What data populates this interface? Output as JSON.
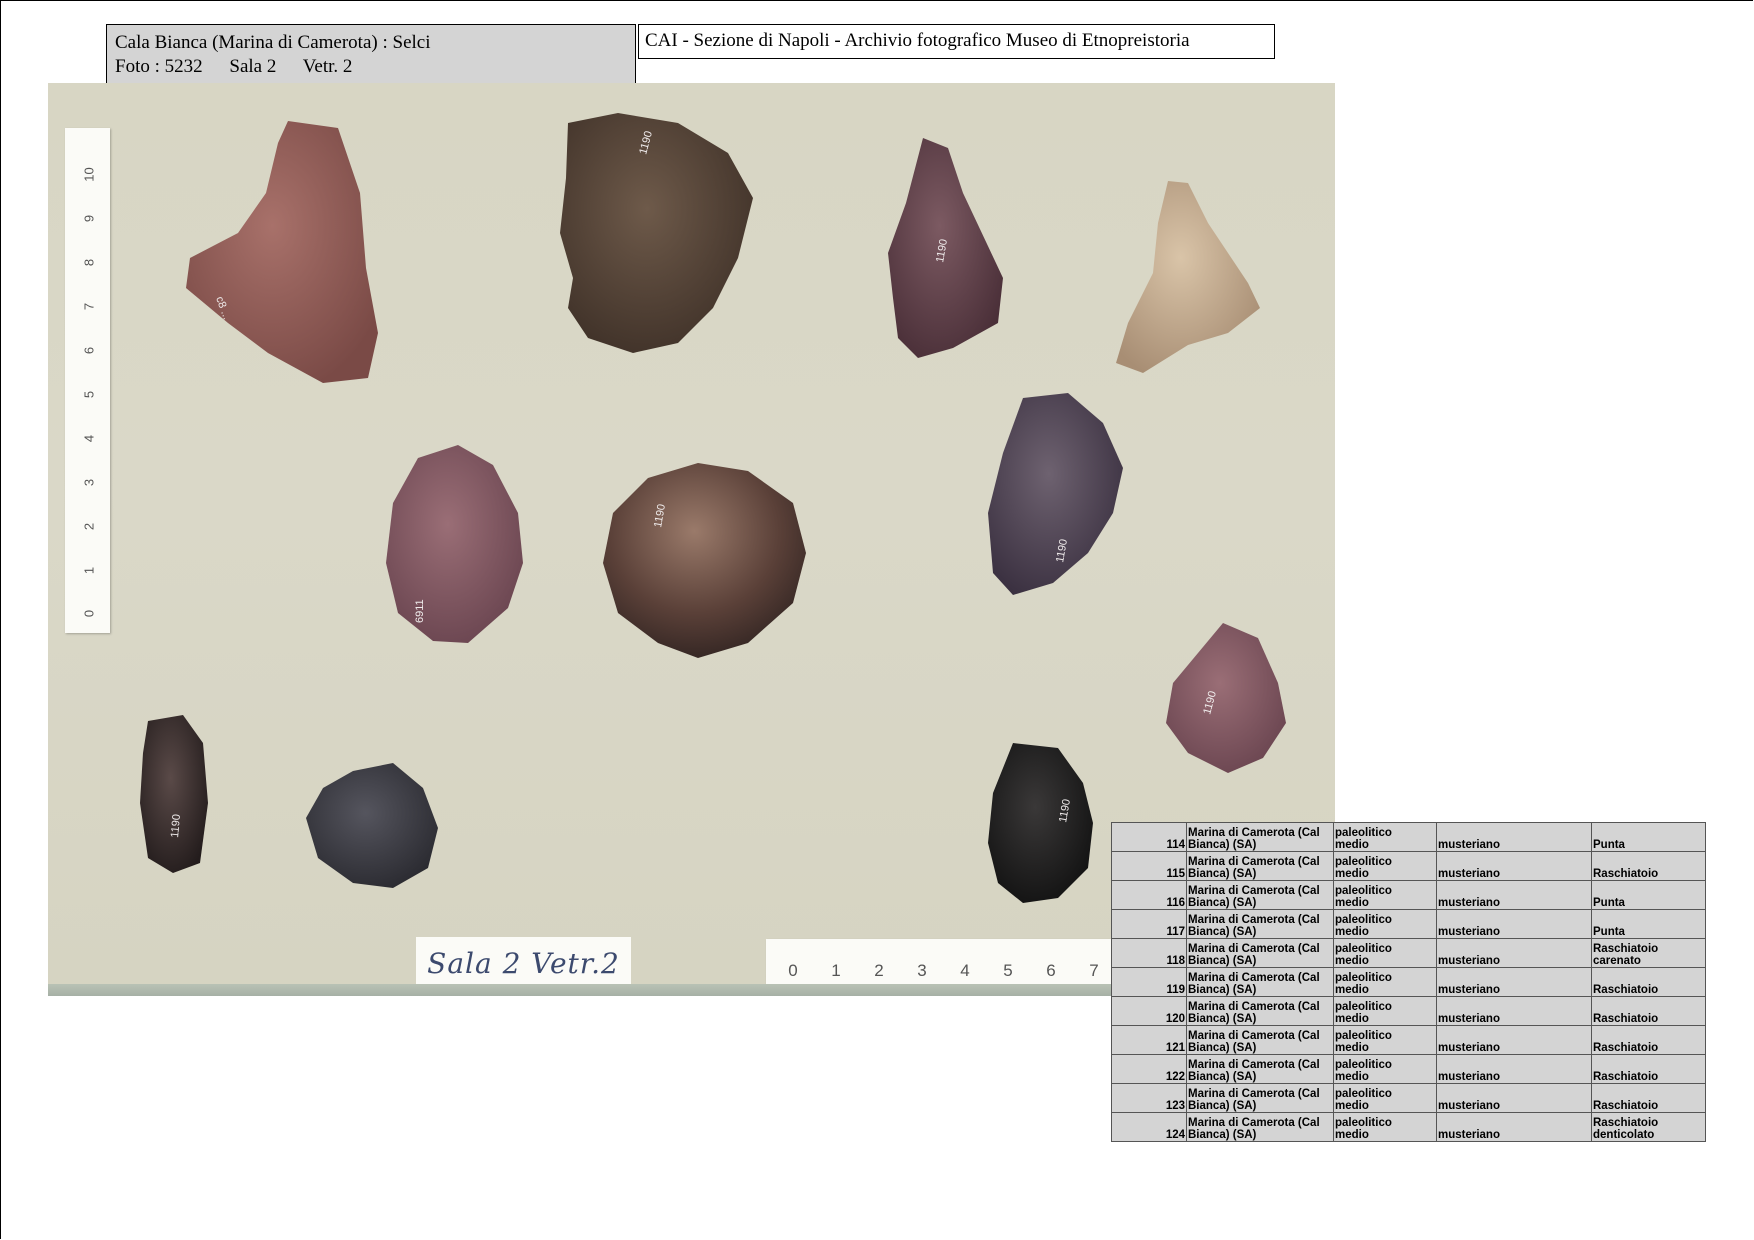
{
  "caption": {
    "title": "Cala Bianca  (Marina di Camerota)  : Selci",
    "photo": "Foto :  5232",
    "sala": "Sala  2",
    "vetr": "Vetr.  2"
  },
  "archive": "CAI - Sezione di Napoli  - Archivio fotografico Museo di Etnopreistoria",
  "photo": {
    "ruler_vertical_marks": [
      "0",
      "1",
      "2",
      "3",
      "4",
      "5",
      "6",
      "7",
      "8",
      "9",
      "10"
    ],
    "ruler_horizontal_marks": [
      "0",
      "1",
      "2",
      "3",
      "4",
      "5",
      "6",
      "7"
    ],
    "handwritten_label": "Sala 2  Vetr.2"
  },
  "catalog": {
    "rows": [
      {
        "num": "114",
        "loc1": "Marina di Camerota (Cal",
        "loc2": "Bianca) (SA)",
        "per1": "paleolitico",
        "per2": "medio",
        "culture": "musteriano",
        "type1": "",
        "type2": "Punta"
      },
      {
        "num": "115",
        "loc1": "Marina di Camerota (Cal",
        "loc2": "Bianca) (SA)",
        "per1": "paleolitico",
        "per2": "medio",
        "culture": "musteriano",
        "type1": "",
        "type2": "Raschiatoio"
      },
      {
        "num": "116",
        "loc1": "Marina di Camerota (Cal",
        "loc2": "Bianca) (SA)",
        "per1": "paleolitico",
        "per2": "medio",
        "culture": "musteriano",
        "type1": "",
        "type2": "Punta"
      },
      {
        "num": "117",
        "loc1": "Marina di Camerota (Cal",
        "loc2": "Bianca) (SA)",
        "per1": "paleolitico",
        "per2": "medio",
        "culture": "musteriano",
        "type1": "",
        "type2": "Punta"
      },
      {
        "num": "118",
        "loc1": "Marina di Camerota (Cal",
        "loc2": "Bianca) (SA)",
        "per1": "paleolitico",
        "per2": "medio",
        "culture": "musteriano",
        "type1": "Raschiatoio",
        "type2": "carenato"
      },
      {
        "num": "119",
        "loc1": "Marina di Camerota (Cal",
        "loc2": "Bianca) (SA)",
        "per1": "paleolitico",
        "per2": "medio",
        "culture": "musteriano",
        "type1": "",
        "type2": "Raschiatoio"
      },
      {
        "num": "120",
        "loc1": "Marina di Camerota (Cal",
        "loc2": "Bianca) (SA)",
        "per1": "paleolitico",
        "per2": "medio",
        "culture": "musteriano",
        "type1": "",
        "type2": "Raschiatoio"
      },
      {
        "num": "121",
        "loc1": "Marina di Camerota (Cal",
        "loc2": "Bianca) (SA)",
        "per1": "paleolitico",
        "per2": "medio",
        "culture": "musteriano",
        "type1": "",
        "type2": "Raschiatoio"
      },
      {
        "num": "122",
        "loc1": "Marina di Camerota (Cal",
        "loc2": "Bianca) (SA)",
        "per1": "paleolitico",
        "per2": "medio",
        "culture": "musteriano",
        "type1": "",
        "type2": "Raschiatoio"
      },
      {
        "num": "123",
        "loc1": "Marina di Camerota (Cal",
        "loc2": "Bianca) (SA)",
        "per1": "paleolitico",
        "per2": "medio",
        "culture": "musteriano",
        "type1": "",
        "type2": "Raschiatoio"
      },
      {
        "num": "124",
        "loc1": "Marina di Camerota (Cal",
        "loc2": "Bianca) (SA)",
        "per1": "paleolitico",
        "per2": "medio",
        "culture": "musteriano",
        "type1": "Raschiatoio",
        "type2": "denticolato"
      }
    ]
  }
}
